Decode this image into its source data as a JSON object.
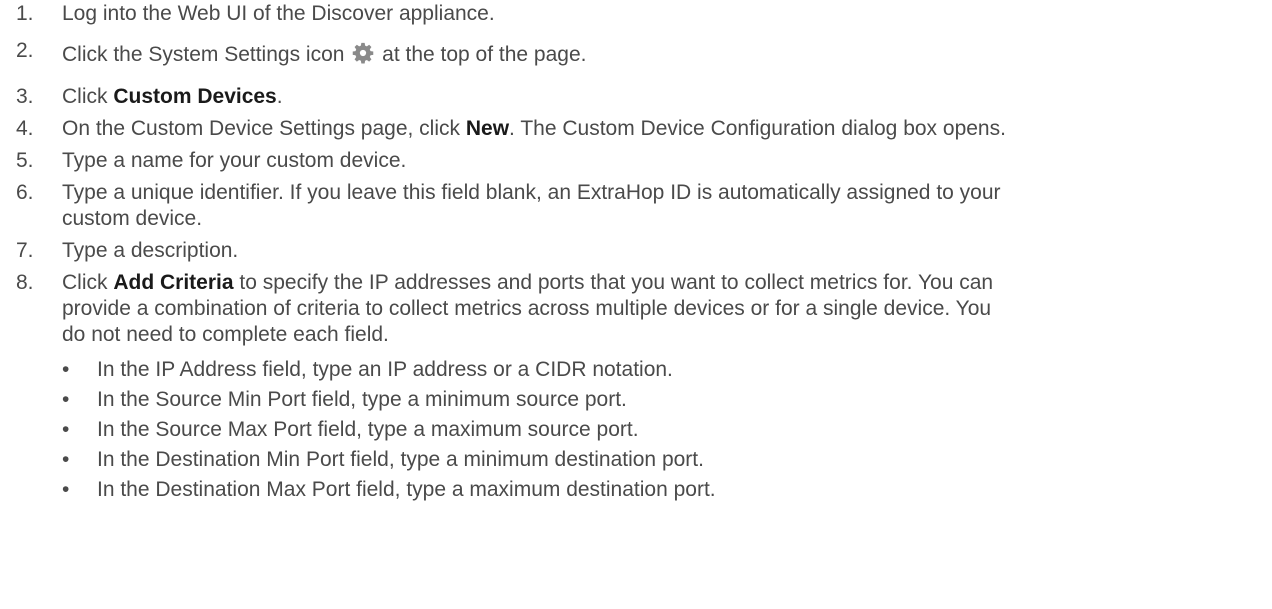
{
  "steps": [
    {
      "num": "1.",
      "text": "Log into the Web UI of the Discover appliance."
    },
    {
      "num": "2.",
      "before": "Click the System Settings icon",
      "icon": "gear-icon",
      "after": "at the top of the page."
    },
    {
      "num": "3.",
      "before": "Click ",
      "bold": "Custom Devices",
      "after": "."
    },
    {
      "num": "4.",
      "before": "On the Custom Device Settings page, click ",
      "bold": "New",
      "after": ". The Custom Device Configuration dialog box opens."
    },
    {
      "num": "5.",
      "text": "Type a name for your custom device."
    },
    {
      "num": "6.",
      "line1": "Type a unique identifier. If you leave this field blank, an ExtraHop ID is automatically assigned to your",
      "line2": "custom device."
    },
    {
      "num": "7.",
      "text": "Type a description."
    },
    {
      "num": "8.",
      "before": "Click ",
      "bold": "Add Criteria",
      "after": " to specify the IP addresses and ports that you want to collect metrics for. You can",
      "line2": "provide a combination of criteria to collect metrics across multiple devices or for a single device. You",
      "line3": "do not need to complete each field."
    }
  ],
  "bullets": [
    "In the IP Address field, type an IP address or a CIDR notation.",
    "In the Source Min Port field, type a minimum source port.",
    "In the Source Max Port field, type a maximum source port.",
    "In the Destination Min Port field, type a minimum destination port.",
    "In the Destination Max Port field, type a maximum destination port."
  ],
  "bullet_glyph": "•",
  "colors": {
    "text": "#4a4a4a",
    "bold": "#1a1a1a",
    "icon": "#8a8a8a"
  }
}
